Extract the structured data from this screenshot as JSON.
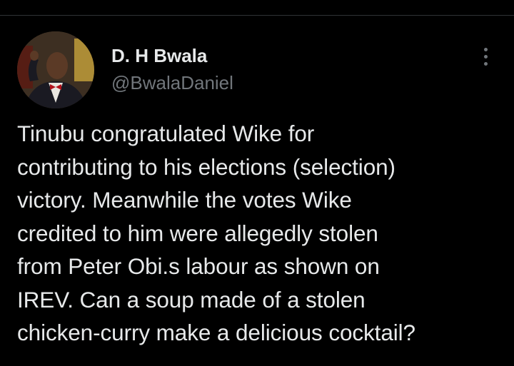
{
  "tweet": {
    "author": {
      "name": "D. H Bwala",
      "handle": "@BwalaDaniel"
    },
    "text": "Tinubu congratulated Wike for\ncontributing to his elections  (selection)\nvictory. Meanwhile the votes Wike\ncredited to him were allegedly stolen\nfrom Peter Obi.s labour as shown on\nIREV. Can a soup made of a stolen\nchicken-curry make a delicious cocktail?",
    "meta": {
      "timestamp": "",
      "views_count": "",
      "views_label": ""
    }
  },
  "icons": {
    "more": "more-vertical-icon"
  },
  "colors": {
    "background": "#000000",
    "text_primary": "#e7e9ea",
    "text_secondary": "#71767b",
    "divider": "#2f3336"
  }
}
